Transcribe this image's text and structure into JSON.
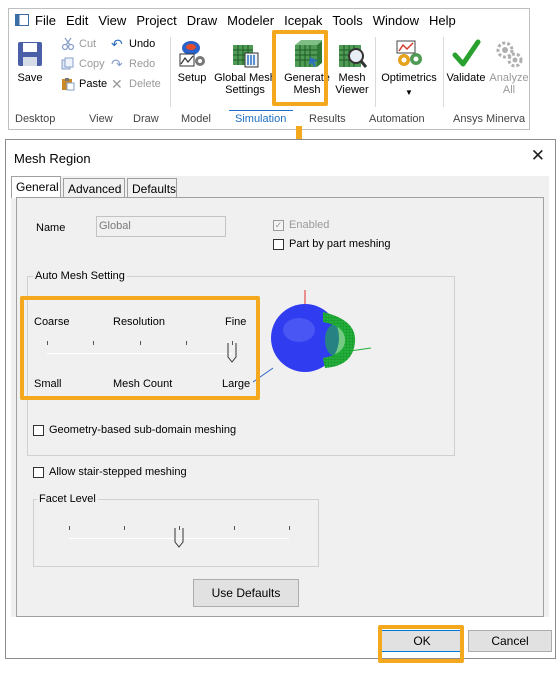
{
  "menu": [
    "File",
    "Edit",
    "View",
    "Project",
    "Draw",
    "Modeler",
    "Icepak",
    "Tools",
    "Window",
    "Help"
  ],
  "ribbon": {
    "save": "Save",
    "cut": "Cut",
    "copy": "Copy",
    "paste": "Paste",
    "undo": "Undo",
    "redo": "Redo",
    "delete": "Delete",
    "setup": "Setup",
    "global_mesh_line1": "Global Mesh",
    "global_mesh_line2": "Settings",
    "generate_mesh_line1": "Generate",
    "generate_mesh_line2": "Mesh",
    "mesh_viewer_line1": "Mesh",
    "mesh_viewer_line2": "Viewer",
    "optimetrics": "Optimetrics",
    "validate": "Validate",
    "analyze_line1": "Analyze",
    "analyze_line2": "All",
    "tabs": [
      "Desktop",
      "View",
      "Draw",
      "Model",
      "Simulation",
      "Results",
      "Automation",
      "Ansys Minerva"
    ],
    "active_tab": "Simulation"
  },
  "dialog": {
    "title": "Mesh Region",
    "tabs": [
      "General",
      "Advanced",
      "Defaults"
    ],
    "active_tab": "General",
    "name_label": "Name",
    "name_value": "Global",
    "enabled_label": "Enabled",
    "enabled_checked": true,
    "part_by_part_label": "Part by part meshing",
    "part_by_part_checked": false,
    "auto_mesh_group": "Auto Mesh Setting",
    "coarse": "Coarse",
    "resolution": "Resolution",
    "fine": "Fine",
    "small": "Small",
    "mesh_count": "Mesh Count",
    "large": "Large",
    "resolution_level": 5,
    "resolution_max": 5,
    "geometry_submesh_label": "Geometry-based sub-domain meshing",
    "geometry_submesh_checked": false,
    "stair_step_label": "Allow stair-stepped meshing",
    "stair_step_checked": false,
    "facet_group": "Facet Level",
    "facet_level": 3,
    "facet_max": 5,
    "use_defaults": "Use Defaults",
    "ok": "OK",
    "cancel": "Cancel"
  },
  "colors": {
    "highlight": "#f4a81d",
    "sphere": "#2f3cf0",
    "mesh_green": "#22b03a",
    "active_tab": "#1e6fc1"
  }
}
